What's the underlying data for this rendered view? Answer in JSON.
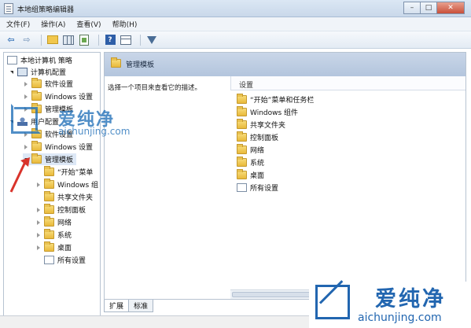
{
  "window": {
    "title": "本地组策略编辑器"
  },
  "window_buttons": {
    "minimize": "–",
    "maximize": "□",
    "close": "✕"
  },
  "menu": [
    "文件(F)",
    "操作(A)",
    "查看(V)",
    "帮助(H)"
  ],
  "toolbar": {
    "icons": [
      "back-arrow-icon",
      "forward-arrow-icon",
      "folder-up-icon",
      "show-hide-tree-icon",
      "export-list-icon",
      "help-icon",
      "view-icon",
      "filter-icon"
    ]
  },
  "tree": {
    "root": "本地计算机 策略",
    "computer_config": "计算机配置",
    "cc_items": [
      "软件设置",
      "Windows 设置",
      "管理模板"
    ],
    "user_config": "用户配置",
    "uc_items": [
      "软件设置",
      "Windows 设置"
    ],
    "admin_templates": "管理模板",
    "at_items": [
      "“开始”菜单",
      "Windows 组",
      "共享文件夹",
      "控制面板",
      "网络",
      "系统",
      "桌面",
      "所有设置"
    ]
  },
  "right": {
    "header_title": "管理模板",
    "description": "选择一个项目来查看它的描述。",
    "list_header": "设置",
    "items": [
      "“开始”菜单和任务栏",
      "Windows 组件",
      "共享文件夹",
      "控制面板",
      "网络",
      "系统",
      "桌面",
      "所有设置"
    ]
  },
  "tabs": [
    "扩展",
    "标准"
  ],
  "watermark": {
    "cn": "爱纯净",
    "en": "aichunjing.com"
  },
  "colors": {
    "accent": "#2266b0",
    "header": "#c9d6e8",
    "annotation": "#d9332b"
  }
}
